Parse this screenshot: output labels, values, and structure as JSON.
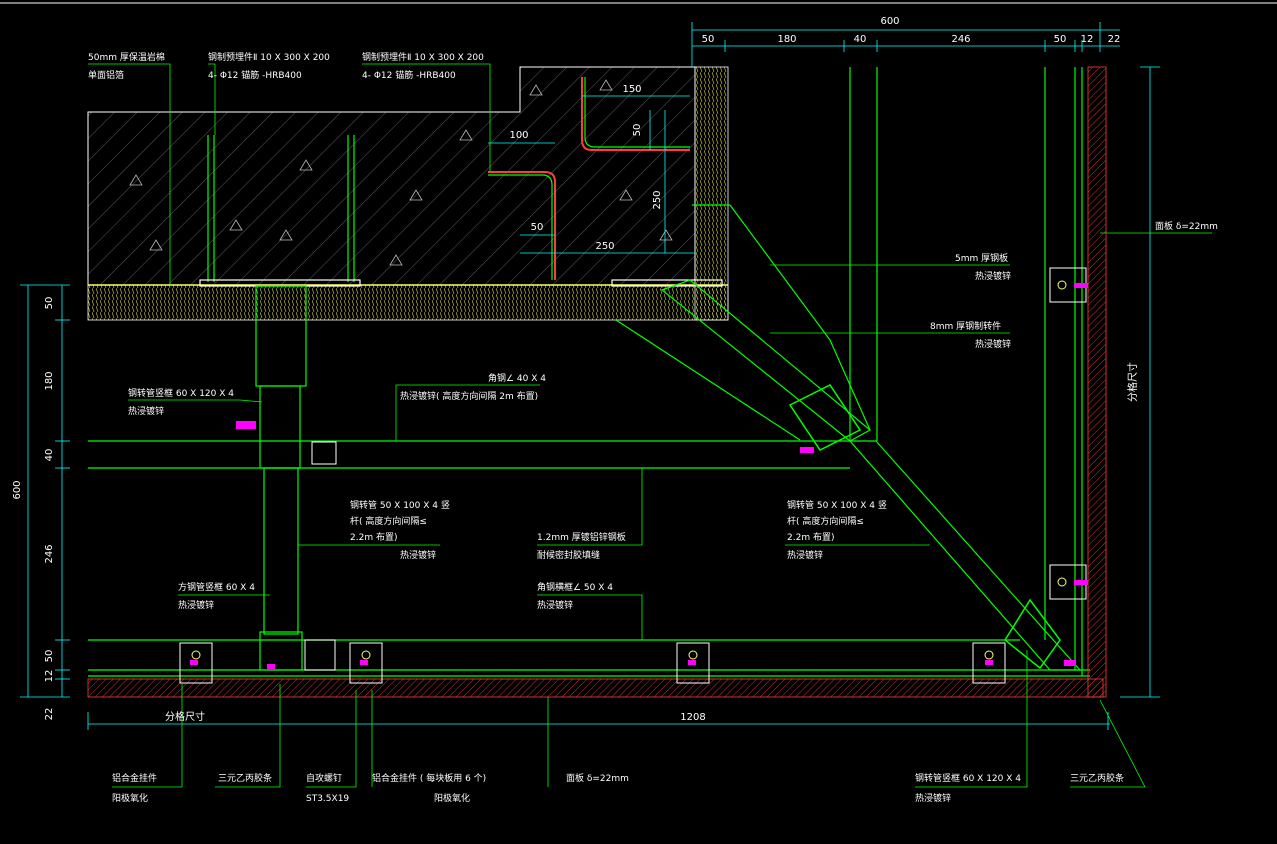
{
  "colors": {
    "background": "#000000",
    "dimension": "#00ffff",
    "steel": "#00ff00",
    "hatch": "#ff3b3b",
    "leader": "#00ff00",
    "text": "#ffffff",
    "fastener": "#ff00ff",
    "insulation": "#ffff66"
  },
  "dimensions": {
    "top_total": "600",
    "top_segments": [
      "50",
      "180",
      "40",
      "246",
      "50",
      "12",
      "22"
    ],
    "left_total": "600",
    "left_segments": [
      "50",
      "180",
      "40",
      "246",
      "50",
      "12",
      "22"
    ],
    "bottom_total": "1208",
    "bottom_left_label": "分格尺寸",
    "right_label": "分格尺寸",
    "anchor_100": "100",
    "anchor_50a": "50",
    "anchor_250a": "250",
    "anchor_150": "150",
    "anchor_50b": "50",
    "anchor_250b": "250"
  },
  "labels": {
    "insulation_line1": "50mm  厚保温岩棉",
    "insulation_line2": "单面铝箔",
    "embed1_line1": "钢制预埋件Ⅱ  10 X 300 X 200",
    "embed1_line2": "4- Φ12 锚筋 -HRB400",
    "embed2_line1": "钢制预埋件Ⅱ  10 X 300 X 200",
    "embed2_line2": "4- Φ12 锚筋 -HRB400",
    "steel_plate5_line1": "5mm  厚钢板",
    "steel_plate5_line2": "热浸镀锌",
    "steel_plate8_line1": "8mm  厚钢制转件",
    "steel_plate8_line2": "热浸镀锌",
    "granite_right": "面板 δ=22mm",
    "tube60_line1": "钢转管竖框  60 X 120 X 4",
    "tube60_line2": "热浸镀锌",
    "angle40_line1": "角钢∠ 40 X 4",
    "angle40_line2": "热浸镀锌( 高度方向间隔    2m  布置)",
    "tube50a_line1": "钢转管  50 X 100  X 4 竖",
    "tube50a_line2": "杆( 高度方向间隔≤",
    "tube50a_line3": "2.2m    布置)",
    "tube50a_line4": "热浸镀锌",
    "backplate_line1": "1.2mm   厚镀铝锌钢板",
    "backplate_line2": "耐候密封胶填缝",
    "tube50b_line1": "钢转管  50 X 100  X 4 竖",
    "tube50b_line2": "杆( 高度方向间隔≤",
    "tube50b_line3": "2.2m    布置)",
    "tube50b_line4": "热浸镀锌",
    "square_tube_line1": "方钢管竖框  60 X 4",
    "square_tube_line2": "热浸镀锌",
    "angle50_line1": "角钢横框∠  50 X 4",
    "angle50_line2": "热浸镀锌",
    "bottom1_line1": "铝合金挂件",
    "bottom1_line2": "阳极氧化",
    "bottom2_line1": "三元乙丙胶条",
    "bottom3_line1": "自攻螺钉",
    "bottom3_line2": "ST3.5X19",
    "bottom4_line1": "铝合金挂件  ( 每块板用  6 个)",
    "bottom4_line2": "阳极氧化",
    "bottom5_line1": "面板  δ=22mm",
    "bottom6_line1": "钢转管竖框  60 X 120  X 4",
    "bottom6_line2": "热浸镀锌",
    "bottom7_line1": "三元乙丙胶条"
  }
}
